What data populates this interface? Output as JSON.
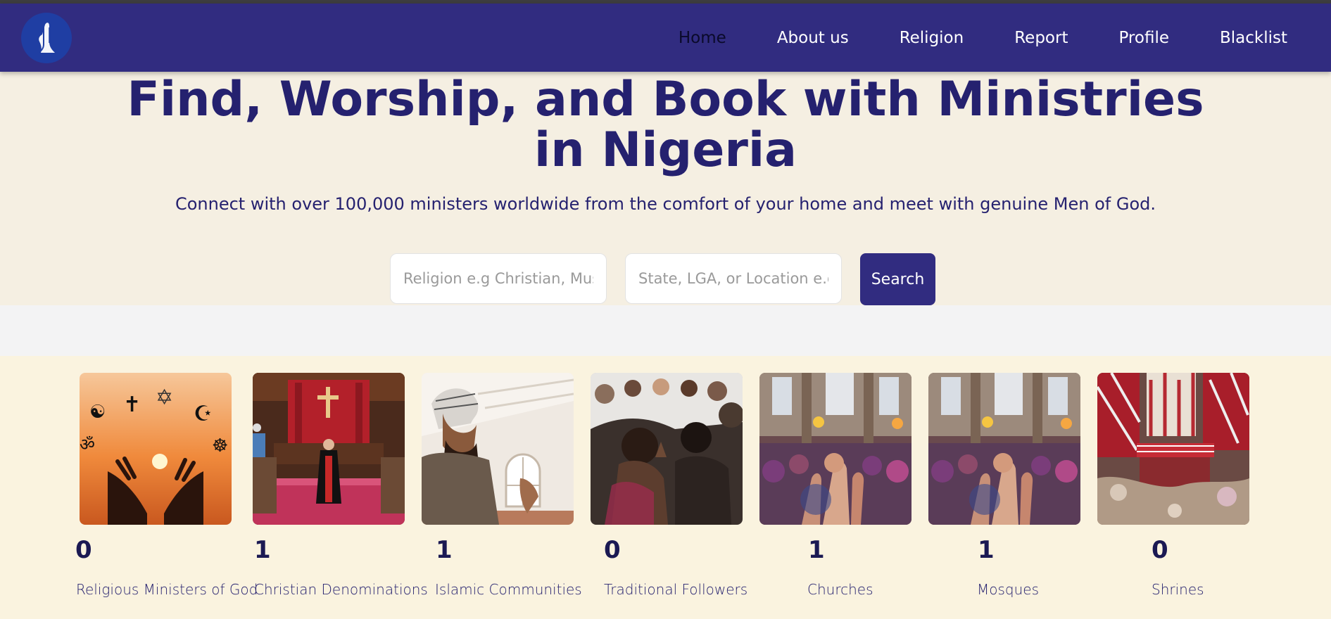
{
  "logo": {
    "icon": "praying-hands-icon"
  },
  "nav": {
    "items": [
      {
        "label": "Home",
        "active": true
      },
      {
        "label": "About us",
        "active": false
      },
      {
        "label": "Religion",
        "active": false
      },
      {
        "label": "Report",
        "active": false
      },
      {
        "label": "Profile",
        "active": false
      },
      {
        "label": "Blacklist",
        "active": false
      }
    ]
  },
  "hero": {
    "title": "Find, Worship, and Book with Ministries in Nigeria",
    "subtitle": "Connect with over 100,000 ministers worldwide from the comfort of your home and meet with genuine Men of God."
  },
  "search": {
    "religion_placeholder": "Religion e.g Christian, Muslim",
    "location_placeholder": "State, LGA, or Location e.g Lagos",
    "button_label": "Search"
  },
  "stats": [
    {
      "count": "0",
      "label": "Religious Ministers of God",
      "image": "religious-symbols-hands-image"
    },
    {
      "count": "1",
      "label": "Christian Denominations",
      "image": "church-altar-minister-image"
    },
    {
      "count": "1",
      "label": "Islamic Communities",
      "image": "muslim-man-praying-image"
    },
    {
      "count": "0",
      "label": "Traditional Followers",
      "image": "praying-congregation-image"
    },
    {
      "count": "1",
      "label": "Churches",
      "image": "church-worship-crowd-image"
    },
    {
      "count": "1",
      "label": "Mosques",
      "image": "worship-crowd-image"
    },
    {
      "count": "0",
      "label": "Shrines",
      "image": "traditional-shrine-image"
    }
  ],
  "colors": {
    "navbar": "#312c80",
    "primary_text": "#25216f",
    "hero_bg": "#f5efe2",
    "cards_bg": "#faf3df"
  }
}
